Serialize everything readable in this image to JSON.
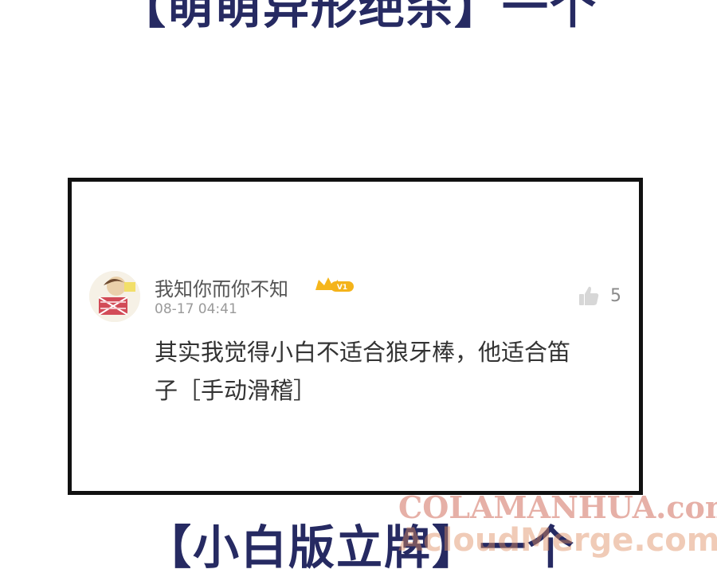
{
  "banners": {
    "top_text": "【萌萌异形绝杀】一个",
    "bottom_text": "【小白版立牌】一个"
  },
  "comment": {
    "username": "我知你而你不知",
    "vip_badge": "V1",
    "timestamp": "08-17 04:41",
    "like_count": "5",
    "text": "其实我觉得小白不适合狼牙棒，他适合笛子［手动滑稽］"
  },
  "watermark": {
    "line1": "COLAMANHUA.com",
    "line2": "AcloudMerge.com"
  },
  "icons": {
    "avatar": "avatar",
    "badge": "crown-icon",
    "like": "thumbs-up-icon"
  },
  "colors": {
    "banner": "#262a62",
    "badge": "#f4b31a",
    "like": "#d7d7d7"
  }
}
